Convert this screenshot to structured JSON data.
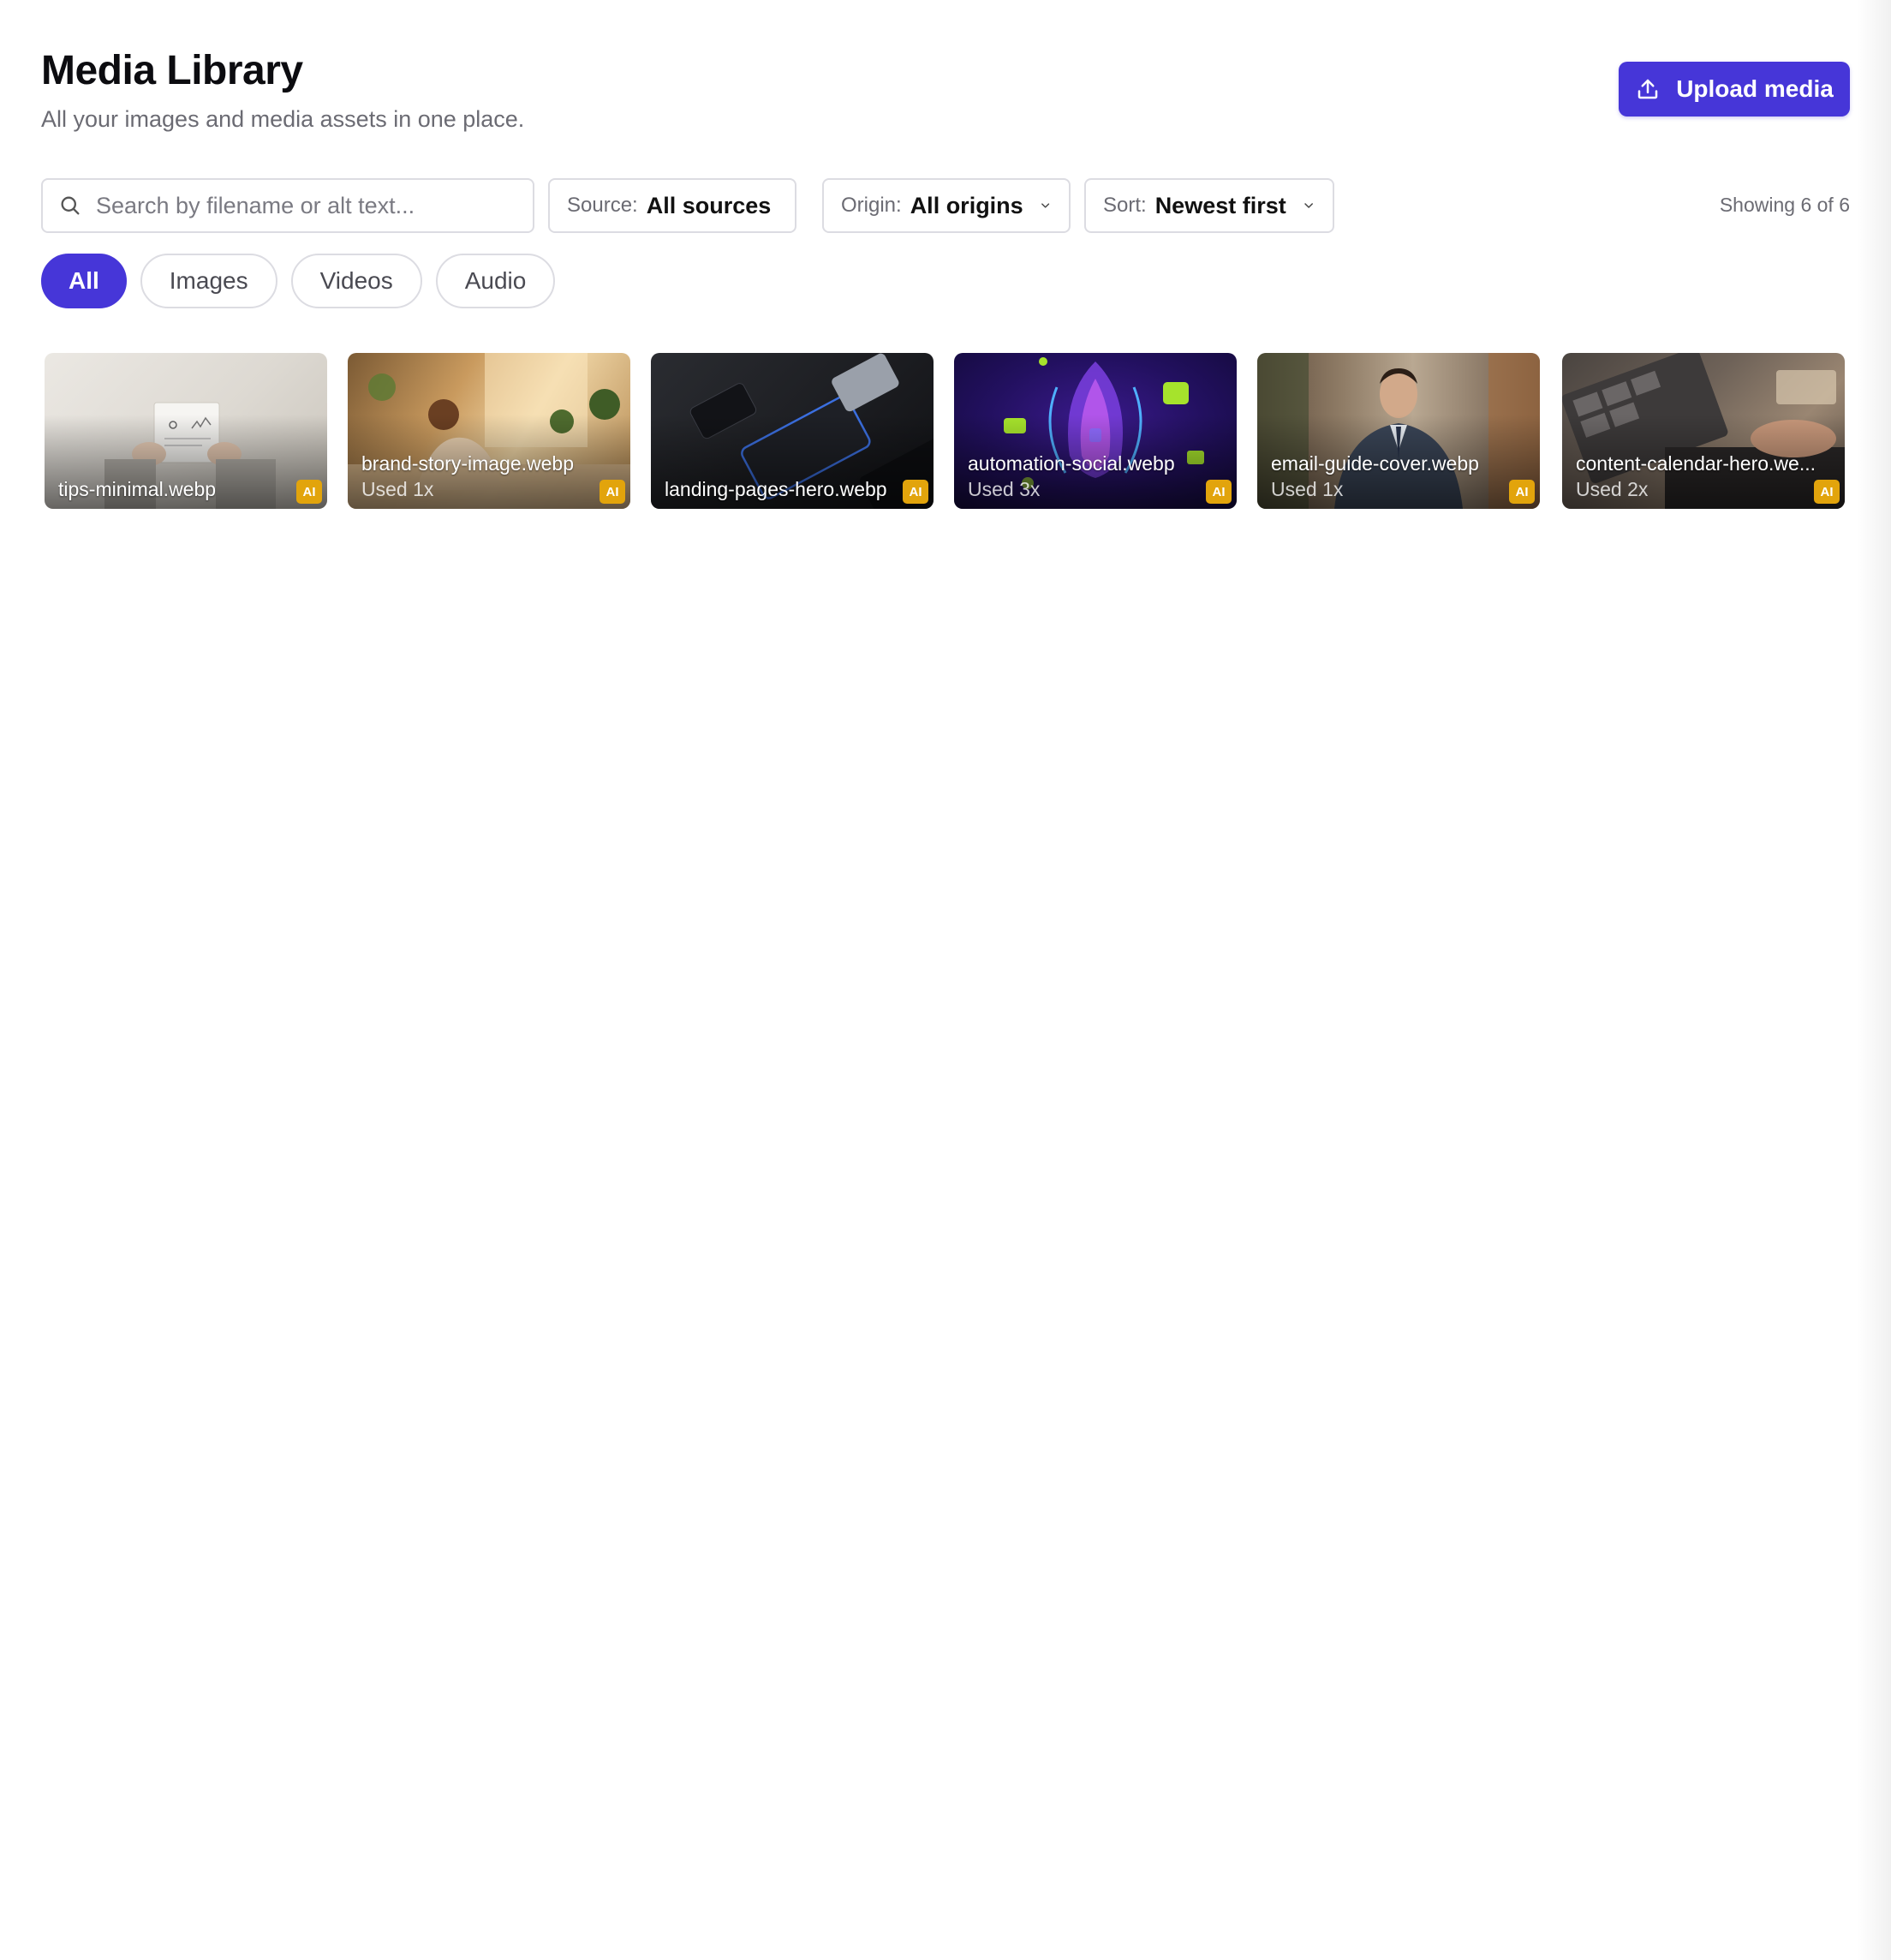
{
  "header": {
    "title": "Media Library",
    "subtitle": "All your images and media assets in one place.",
    "upload_label": "Upload media"
  },
  "search": {
    "placeholder": "Search by filename or alt text..."
  },
  "filters": {
    "source": {
      "label": "Source:",
      "value": "All sources"
    },
    "origin": {
      "label": "Origin:",
      "value": "All origins"
    },
    "sort": {
      "label": "Sort:",
      "value": "Newest first"
    }
  },
  "showing": "Showing 6 of 6",
  "tabs": [
    {
      "label": "All",
      "active": true
    },
    {
      "label": "Images",
      "active": false
    },
    {
      "label": "Videos",
      "active": false
    },
    {
      "label": "Audio",
      "active": false
    }
  ],
  "media": [
    {
      "filename": "tips-minimal.webp",
      "used": "",
      "badge": "AI"
    },
    {
      "filename": "brand-story-image.webp",
      "used": "Used 1x",
      "badge": "AI"
    },
    {
      "filename": "landing-pages-hero.webp",
      "used": "",
      "badge": "AI"
    },
    {
      "filename": "automation-social.webp",
      "used": "Used 3x",
      "badge": "AI"
    },
    {
      "filename": "email-guide-cover.webp",
      "used": "Used 1x",
      "badge": "AI"
    },
    {
      "filename": "content-calendar-hero.we...",
      "used": "Used 2x",
      "badge": "AI"
    }
  ],
  "colors": {
    "accent": "#4636d8",
    "ai_badge": "#e2a40c"
  }
}
